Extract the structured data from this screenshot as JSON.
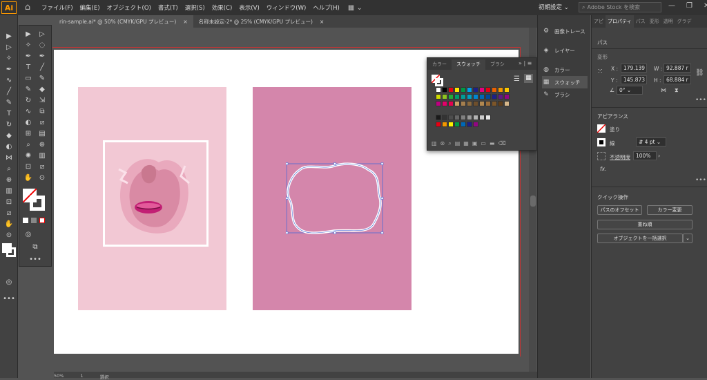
{
  "menubar": {
    "logo": "Ai",
    "items": [
      "ファイル(F)",
      "編集(E)",
      "オブジェクト(O)",
      "書式(T)",
      "選択(S)",
      "効果(C)",
      "表示(V)",
      "ウィンドウ(W)",
      "ヘルプ(H)"
    ],
    "workspace": "初期設定",
    "search_placeholder": "Adobe Stock を検索"
  },
  "tabs": [
    {
      "label": "rin-sample.ai* @ 50% (CMYK/GPU プレビュー)",
      "close": "×"
    },
    {
      "label": "名称未設定-2* @ 25% (CMYK/GPU プレビュー)",
      "close": "×"
    }
  ],
  "swatches_panel": {
    "tabs": [
      "カラー",
      "スウォッチ",
      "ブラシ"
    ],
    "colors_row1": [
      "#ffffff",
      "#000000",
      "#e30613",
      "#ffe600",
      "#009944",
      "#00a0e9",
      "#1d2088",
      "#e4007f",
      "#e60012",
      "#eb6100",
      "#f39800",
      "#fcc800"
    ],
    "colors_row2": [
      "#cfdb00",
      "#8fc31f",
      "#22ac38",
      "#009b6b",
      "#009e96",
      "#00a0c1",
      "#0086d1",
      "#0068b7",
      "#00479d",
      "#1d2088",
      "#601986",
      "#920783"
    ],
    "colors_row3": [
      "#be0081",
      "#e5006a",
      "#e5004f",
      "#c9a063",
      "#a57f4e",
      "#8b6a3e",
      "#6e4f2c",
      "#b28850",
      "#9c6e3a",
      "#7d5629",
      "#5e3e1c",
      "#d6b78a"
    ],
    "colors_row5": [
      "#1a1a1a",
      "#333333",
      "#4d4d4d",
      "#666666",
      "#808080",
      "#999999",
      "#b3b3b3",
      "#cccccc",
      "#e6e6e6"
    ],
    "colors_row6": [
      "#e60012",
      "#f39800",
      "#fff100",
      "#009944",
      "#0068b7",
      "#1d2088",
      "#920783"
    ]
  },
  "dock": {
    "items": [
      "画像トレース",
      "レイヤー",
      "カラー",
      "スウォッチ",
      "ブラシ"
    ]
  },
  "properties": {
    "tabs": [
      "アピ",
      "プロパティ",
      "パス",
      "変形",
      "透明",
      "グラデ"
    ],
    "section_path": "パス",
    "section_transform": "変形",
    "x_label": "X :",
    "x_value": "179.139",
    "y_label": "Y :",
    "y_value": "145.873",
    "w_label": "W :",
    "w_value": "92.887 r",
    "h_label": "H :",
    "h_value": "68.884 r",
    "rotate_value": "0°",
    "appearance_title": "アピアランス",
    "fill_label": "塗り",
    "stroke_label": "線",
    "stroke_value": "4 pt",
    "opacity_label": "不透明度",
    "opacity_value": "100%",
    "fx_label": "fx.",
    "quick_actions_title": "クイック操作",
    "offset_path_button": "パスのオフセット",
    "recolor_button": "カラー変更",
    "arrange_button": "重ね順",
    "select_same_button": "オブジェクトを一括選択"
  },
  "statusbar": {
    "zoom": "50%",
    "page": "1",
    "mode": "選択"
  },
  "colors": {
    "photo_bg": "#f2c8d4",
    "pink_card": "#d486ab",
    "selection": "#4a6ad6"
  }
}
